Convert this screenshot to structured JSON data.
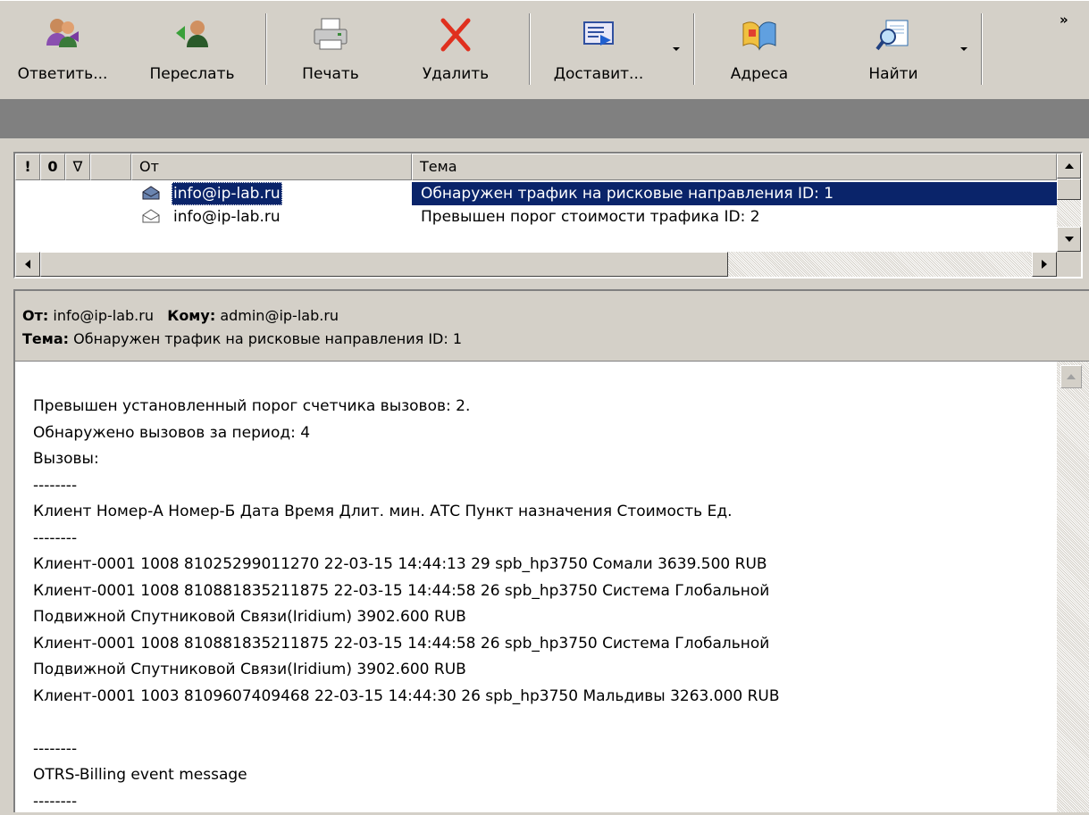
{
  "toolbar": {
    "reply": "Ответить...",
    "forward": "Переслать",
    "print": "Печать",
    "delete": "Удалить",
    "deliver": "Доставит...",
    "addresses": "Адреса",
    "find": "Найти",
    "overflow": "»"
  },
  "list": {
    "headers": {
      "priority": "!",
      "attachment": "0",
      "flag": "∇",
      "from": "От",
      "subject": "Тема"
    },
    "rows": [
      {
        "from": "info@ip-lab.ru",
        "subject": "Обнаружен трафик на рисковые направления ID: 1",
        "selected": true
      },
      {
        "from": "info@ip-lab.ru",
        "subject": "Превышен порог стоимости трафика ID: 2",
        "selected": false
      }
    ]
  },
  "preview": {
    "from_label": "От:",
    "from": "info@ip-lab.ru",
    "to_label": "Кому:",
    "to": "admin@ip-lab.ru",
    "subject_label": "Тема:",
    "subject": "Обнаружен трафик на рисковые направления ID: 1",
    "body": "Превышен установленный порог счетчика вызовов: 2.\nОбнаружено вызовов за период: 4\nВызовы:\n--------\nКлиент Номер-А Номер-Б Дата Время Длит. мин. АТС Пункт назначения Стоимость Ед.\n--------\nКлиент-0001 1008 81025299011270 22-03-15 14:44:13 29 spb_hp3750 Сомали 3639.500 RUB\nКлиент-0001 1008 810881835211875 22-03-15 14:44:58 26 spb_hp3750 Система Глобальной\nПодвижной Спутниковой Связи(Iridium) 3902.600 RUB\nКлиент-0001 1008 810881835211875 22-03-15 14:44:58 26 spb_hp3750 Система Глобальной\nПодвижной Спутниковой Связи(Iridium) 3902.600 RUB\nКлиент-0001 1003 8109607409468 22-03-15 14:44:30 26 spb_hp3750 Мальдивы 3263.000 RUB\n\n--------\nOTRS-Billing event message\n--------"
  },
  "colors": {
    "selection": "#0a246a",
    "chrome": "#d4d0c8",
    "gray_bar": "#808080"
  }
}
